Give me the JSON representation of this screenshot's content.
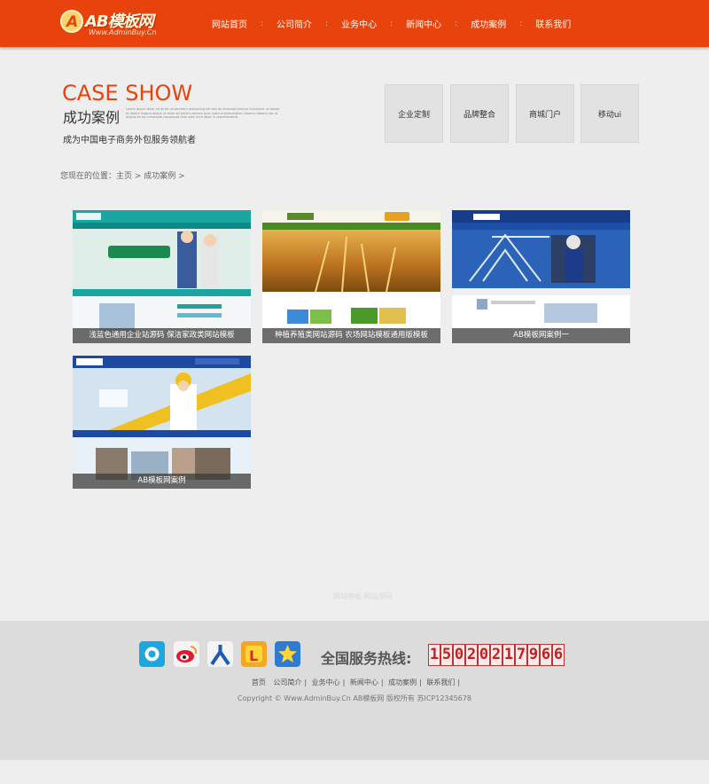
{
  "header": {
    "logo_name": "AB模板网",
    "logo_sub": "Www.AdminBuy.Cn",
    "nav": [
      "网站首页",
      "公司简介",
      "业务中心",
      "新闻中心",
      "成功案例",
      "联系我们"
    ],
    "nav_separator": ":"
  },
  "banner": {
    "title_en": "CASE SHOW",
    "title_cn": "成功案例",
    "description": "Lorem ipsum dolor sit amet consectetur adipiscing elit sed do eiusmod tempor incididunt ut labore et dolore magna aliqua ut enim ad minim veniam quis nostrud exercitation ullamco laboris nisi ut aliquip ex ea commodo consequat duis aute irure dolor in reprehenderit",
    "slogan": "成为中国电子商务外包服务领航者",
    "categories": [
      "企业定制",
      "品牌整合",
      "商城门户",
      "移动ui"
    ]
  },
  "breadcrumb": "您现在的位置：主页 > 成功案例 >",
  "cases": [
    {
      "caption": "浅蓝色通用企业站源码 保洁家政类网站模板",
      "theme": "teal"
    },
    {
      "caption": "种植养殖类网站源码 农场网站模板通用版模板",
      "theme": "wheat"
    },
    {
      "caption": "AB模板网案例一",
      "theme": "blue"
    },
    {
      "caption": "AB模板网案例",
      "theme": "builder"
    }
  ],
  "faint_text": "网站模板 网站源码",
  "footer": {
    "icons": [
      "pp-icon",
      "weibo-icon",
      "renren-icon",
      "tudou-icon",
      "star-icon"
    ],
    "hotline_label": "全国服务热线:",
    "hotline": "15020217966",
    "links": [
      "首页",
      "公司简介",
      "业务中心",
      "新闻中心",
      "成功案例",
      "联系我们"
    ],
    "copyright": "Copyright © Www.AdminBuy.Cn AB模板网 版权所有  苏ICP12345678"
  },
  "colors": {
    "brand": "#e8430c",
    "footer_bg": "#dcdcdc",
    "page_bg": "#eeeeee"
  }
}
